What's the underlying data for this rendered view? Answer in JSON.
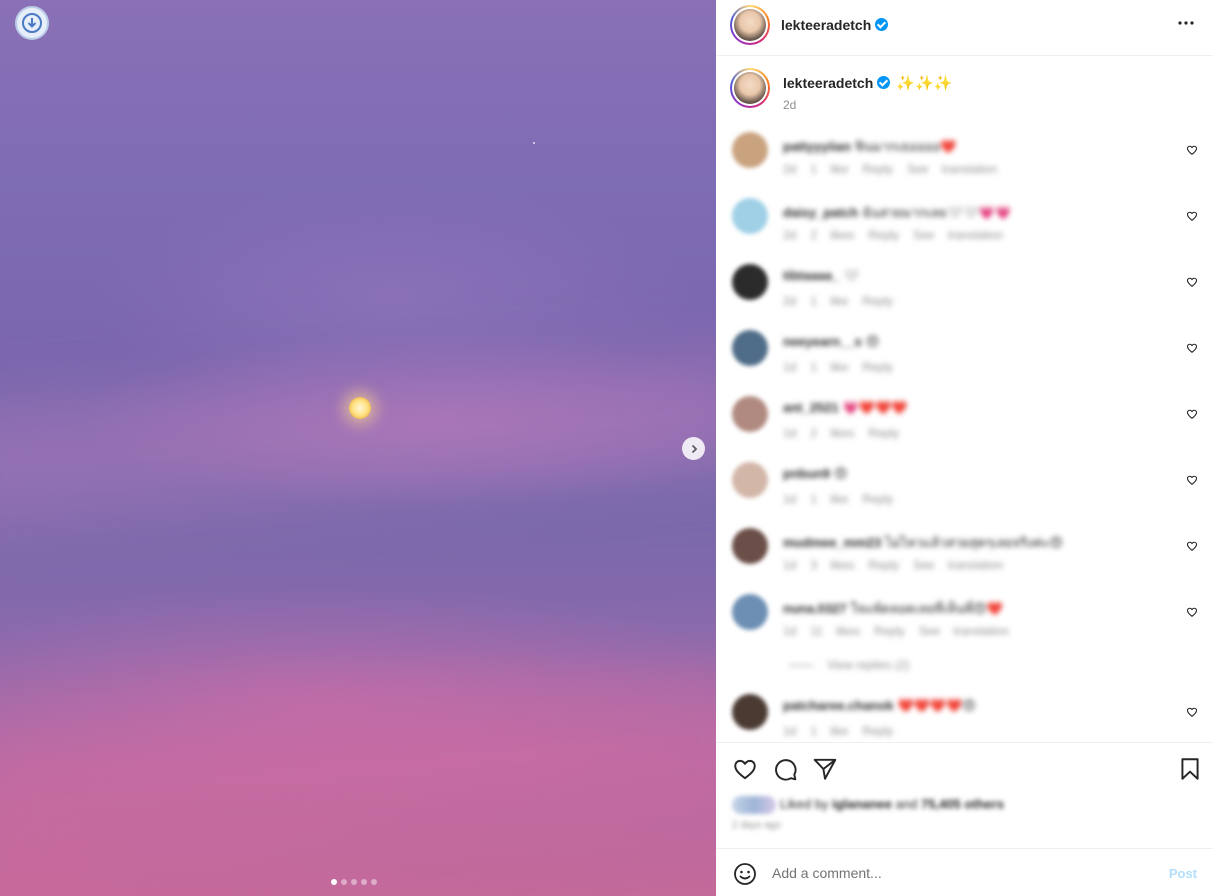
{
  "post": {
    "author": "lekteeradetch",
    "caption_emoji": "✨✨✨",
    "time": "2d",
    "more_icon": "more-horizontal-icon"
  },
  "media": {
    "slide_count": 5,
    "active_slide": 1
  },
  "comments": [
    {
      "user": "pattyyyiian",
      "text": "ฟินมากเธออออ",
      "emoji": "❤️",
      "time": "2d",
      "likes": "1 like",
      "reply": "Reply",
      "translate": "See translation",
      "avatar_color": "#c9a27e"
    },
    {
      "user": "daisy_patch",
      "text": "ฉันสวยมากเลย",
      "emoji": "🤍🤍💗💗",
      "time": "2d",
      "likes": "2 likes",
      "reply": "Reply",
      "translate": "See translation",
      "avatar_color": "#9fd0e6"
    },
    {
      "user": "tibtaaaa_",
      "text": "",
      "emoji": "🤍",
      "time": "2d",
      "likes": "1 like",
      "reply": "Reply",
      "translate": "",
      "avatar_color": "#2b2b2b"
    },
    {
      "user": "neeyearn__s",
      "text": "",
      "emoji": "😍",
      "time": "1d",
      "likes": "1 like",
      "reply": "Reply",
      "translate": "",
      "avatar_color": "#4f6c88"
    },
    {
      "user": "ant_2521",
      "text": "",
      "emoji": "💗❤️❤️❤️",
      "time": "1d",
      "likes": "2 likes",
      "reply": "Reply",
      "translate": "",
      "avatar_color": "#b08a80"
    },
    {
      "user": "pnbun9",
      "text": "",
      "emoji": "😍",
      "time": "1d",
      "likes": "1 like",
      "reply": "Reply",
      "translate": "",
      "avatar_color": "#d2b6a8"
    },
    {
      "user": "mudmee_mm23",
      "text": "ไม่ไหวแล้วสวยสุดๆเลยจริงค่ะ",
      "emoji": "😍",
      "time": "1d",
      "likes": "3 likes",
      "reply": "Reply",
      "translate": "See translation",
      "avatar_color": "#6b4e48"
    },
    {
      "user": "nuna.0327",
      "text": "ใจแพ้ตลอดเลยที่เห็นพี่",
      "emoji": "😍❤️",
      "time": "1d",
      "likes": "11 likes",
      "reply": "Reply",
      "translate": "See translation",
      "avatar_color": "#6d8fb3"
    },
    {
      "user": "patcharee.chanok",
      "text": "",
      "emoji": "❤️❤️❤️❤️😍",
      "time": "1d",
      "likes": "1 like",
      "reply": "Reply",
      "translate": "",
      "avatar_color": "#4a3a32"
    }
  ],
  "view_replies": "View replies (2)",
  "likes": {
    "prefix": "Liked by",
    "user": "iglananee",
    "middle": "and",
    "others": "75,405 others"
  },
  "when": "2 days ago",
  "composer": {
    "placeholder": "Add a comment...",
    "post_label": "Post",
    "emoji_icon": "smiley-icon"
  },
  "colors": {
    "verified": "#0095f6",
    "post_disabled": "#b2dffc"
  }
}
